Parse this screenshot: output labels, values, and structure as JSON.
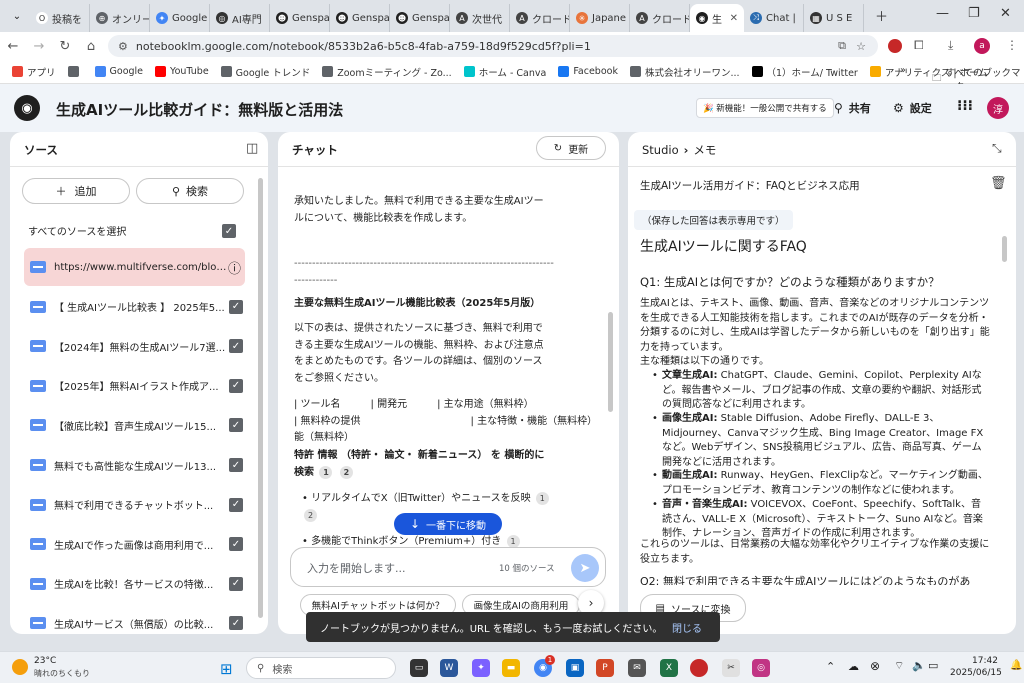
{
  "browser": {
    "tabs": [
      {
        "label": "投稿を",
        "color": "#fff",
        "glyph": "O",
        "fg": "#333"
      },
      {
        "label": "オンリー",
        "color": "#5f6368",
        "glyph": "⊕"
      },
      {
        "label": "Google",
        "color": "#4285f4",
        "glyph": "✦"
      },
      {
        "label": "AI専門",
        "color": "#333",
        "glyph": "◎"
      },
      {
        "label": "Genspa",
        "color": "#222",
        "glyph": "☻"
      },
      {
        "label": "Genspa",
        "color": "#222",
        "glyph": "☻"
      },
      {
        "label": "Genspa",
        "color": "#222",
        "glyph": "☻"
      },
      {
        "label": "次世代",
        "color": "#444",
        "glyph": "A"
      },
      {
        "label": "クロード",
        "color": "#444",
        "glyph": "A"
      },
      {
        "label": "Japane",
        "color": "#e8743b",
        "glyph": "✳"
      },
      {
        "label": "クロード",
        "color": "#444",
        "glyph": "A"
      }
    ],
    "active_tab": {
      "label": "生",
      "glyph": "◉"
    },
    "after_tabs": [
      {
        "label": "Chat |",
        "color": "#2b6cb0",
        "glyph": "⤨"
      },
      {
        "label": "U S E",
        "color": "#333",
        "glyph": "▦"
      }
    ],
    "url": "notebooklm.google.com/notebook/8533b2a6-b5c8-4fab-a759-18d9f529cd5f?pli=1",
    "profile_initial": "a",
    "bookmarks": [
      {
        "label": "アプリ",
        "color": "#ea4335"
      },
      {
        "label": "",
        "color": "#5f6368"
      },
      {
        "label": "Google",
        "color": "#4285f4"
      },
      {
        "label": "YouTube",
        "color": "#ff0000"
      },
      {
        "label": "Google トレンド",
        "color": "#5f6368"
      },
      {
        "label": "Zoomミーティング - Zo...",
        "color": "#5f6368"
      },
      {
        "label": "ホーム - Canva",
        "color": "#00c4cc"
      },
      {
        "label": "Facebook",
        "color": "#1877f2"
      },
      {
        "label": "株式会社オリーワン...",
        "color": "#5f6368"
      },
      {
        "label": "（1）ホーム/ Twitter",
        "color": "#000"
      },
      {
        "label": "アナリティクス | ホーム",
        "color": "#f9ab00"
      }
    ],
    "bookmarks_more": "»",
    "all_bookmarks": "すべてのブックマーク"
  },
  "app": {
    "title": "生成AIツール比較ガイド：無料版と活用法",
    "new_feature": "🎉 新機能！一般公開で共有する",
    "share": "共有",
    "settings": "設定",
    "avatar": "淳"
  },
  "sources": {
    "header": "ソース",
    "add": "追加",
    "search": "検索",
    "select_all": "すべてのソースを選択",
    "items": [
      "https://www.multifverse.com/blog-...",
      "【 生成AIツール比較表 】 2025年5...",
      "【2024年】無料の生成AIツール7選...",
      "【2025年】無料AIイラスト作成ア...",
      "【徹底比較】音声生成AIツール15...",
      "無料でも高性能な生成AIツール13...",
      "無料で利用できるチャットボット...",
      "生成AIで作った画像は商用利用で...",
      "生成AIを比較！各サービスの特徴...",
      "生成AIサービス（無償版）の比較..."
    ]
  },
  "chat": {
    "header": "チャット",
    "refresh": "更新",
    "intro": "承知いたしました。無料で利用できる主要な生成AIツールについて、機能比較表を作成します。",
    "dashes": "------------------------------------------------------------------------------------",
    "table_title": "主要な無料生成AIツール機能比較表（2025年5月版）",
    "table_desc": "以下の表は、提供されたソースに基づき、無料で利用できる主要な生成AIツールの機能、無料枠、および注意点をまとめたものです。各ツールの詳細は、個別のソースをご参照ください。",
    "row1": "| ツール名　　　| 開発元　　　| 主な用途（無料枠）",
    "row2": "| 無料枠の提供　　　　　　　　　　　| 主な特徴・機能（無料枠）",
    "feature": "特許 情報 （特許・ 論文・ 新着ニュース） を 横断的に検索",
    "cite1": "1",
    "cite2": "2",
    "bullet1": "• リアルタイムでX（旧Twitter）やニュースを反映",
    "bullet1_cite1": "1",
    "bullet1_cite2": "2",
    "bullet2": "• 多機能でThinkボタン（Premium+）付き",
    "bullet2_cite": "1",
    "scroll_bottom": "一番下に移動",
    "input_placeholder": "入力を開始します...",
    "source_count": "10 個のソース",
    "suggestion1": "無料AIチャットボットは何か？",
    "suggestion2": "画像生成AIの商用利用"
  },
  "studio": {
    "crumb_studio": "Studio",
    "crumb_memo": "メモ",
    "note_title": "生成AIツール活用ガイド：FAQとビジネス応用",
    "readonly": "（保存した回答は表示専用です）",
    "heading": "生成AIツールに関するFAQ",
    "q1": "Q1: 生成AIとは何ですか？どのような種類がありますか？",
    "p1": "生成AIとは、テキスト、画像、動画、音声、音楽などのオリジナルコンテンツを生成できる人工知能技術を指します。これまでのAIが既存のデータを分析・分類するのに対し、生成AIは学習したデータから新しいものを「創り出す」能力を持っています。",
    "p2": "主な種類は以下の通りです。",
    "b1_label": "文章生成AI:",
    "b1": " ChatGPT、Claude、Gemini、Copilot、Perplexity AIなど。報告書やメール、ブログ記事の作成、文章の要約や翻訳、対話形式の質問応答などに利用されます。",
    "b2_label": "画像生成AI:",
    "b2": " Stable Diffusion、Adobe Firefly、DALL-E 3、Midjourney、Canvaマジック生成、Bing Image Creator、Image FXなど。Webデザイン、SNS投稿用ビジュアル、広告、商品写真、ゲーム開発などに活用されます。",
    "b3_label": "動画生成AI:",
    "b3": " Runway、HeyGen、FlexClipなど。マーケティング動画、プロモーションビデオ、教育コンテンツの制作などに使われます。",
    "b4_label": "音声・音楽生成AI:",
    "b4": " VOICEVOX、CoeFont、Speechify、SoftTalk、音読さん、VALL-E X（Microsoft）、テキストトーク、Suno AIなど。音楽制作、ナレーション、音声ガイドの作成に利用されます。",
    "p3": "これらのツールは、日常業務の大幅な効率化やクリエイティブな作業の支援に役立ちます。",
    "q2": "Q2: 無料で利用できる主要な生成AIツールにはどのようなものがあ",
    "convert": "ソースに変換"
  },
  "toast": {
    "message": "ノートブックが見つかりません。URL を確認し、もう一度お試しください。",
    "close": "閉じる"
  },
  "taskbar": {
    "temp": "23°C",
    "weather": "晴れのちくもり",
    "search": "検索",
    "time": "17:42",
    "date": "2025/06/15",
    "badge": "1"
  }
}
